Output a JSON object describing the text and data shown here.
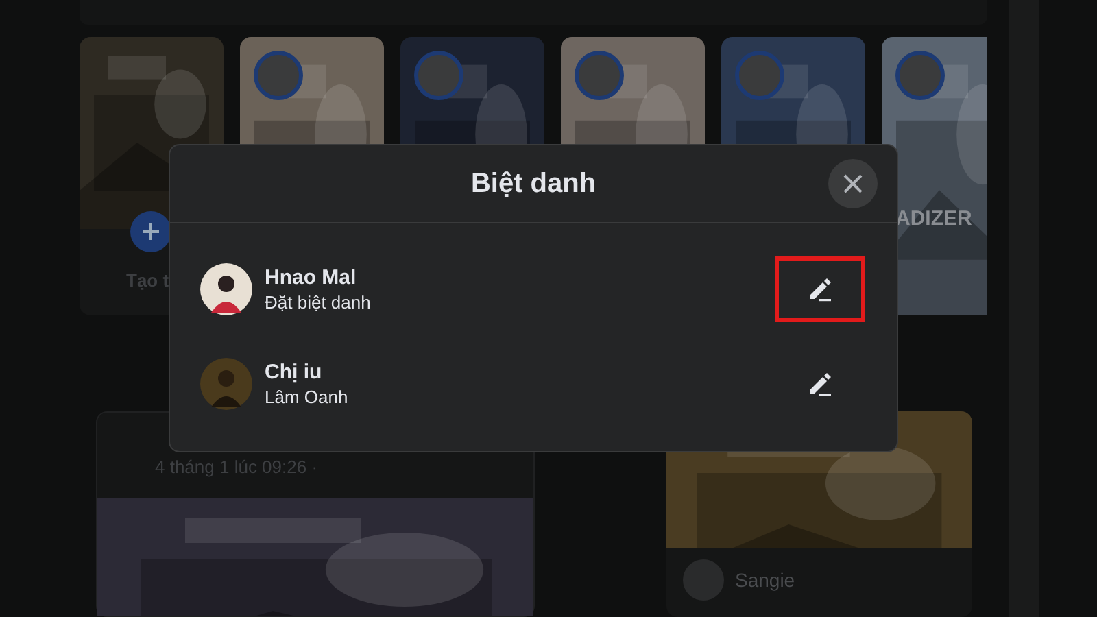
{
  "background": {
    "stories": [
      {
        "kind": "create",
        "label": "Tạo t"
      },
      {
        "kind": "story"
      },
      {
        "kind": "story"
      },
      {
        "kind": "story"
      },
      {
        "kind": "story"
      },
      {
        "kind": "story"
      }
    ],
    "side_label": "ADIZER",
    "post": {
      "time": "4 tháng 1 lúc 09:26 ·"
    },
    "side_post": {
      "author": "Sangie"
    }
  },
  "dialog": {
    "title": "Biệt danh",
    "members": [
      {
        "name": "Hnao Mal",
        "subtitle": "Đặt biệt danh",
        "highlighted": true
      },
      {
        "name": "Chị iu",
        "subtitle": "Lâm Oanh",
        "highlighted": false
      }
    ]
  }
}
